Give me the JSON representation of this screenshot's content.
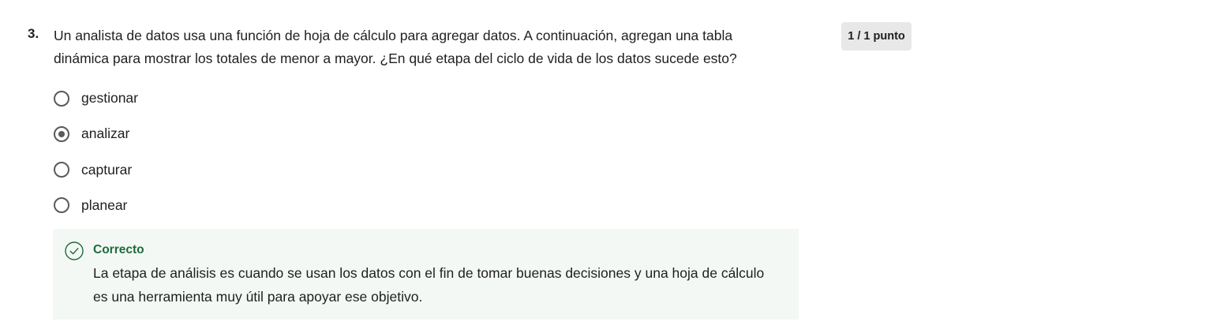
{
  "question": {
    "number": "3.",
    "text": "Un analista de datos usa una función de hoja de cálculo para agregar datos. A continuación, agregan una tabla dinámica para mostrar los totales de menor a mayor. ¿En qué etapa del ciclo de vida de los datos sucede esto?",
    "score": "1 / 1 punto"
  },
  "options": [
    {
      "label": "gestionar",
      "selected": false
    },
    {
      "label": "analizar",
      "selected": true
    },
    {
      "label": "capturar",
      "selected": false
    },
    {
      "label": "planear",
      "selected": false
    }
  ],
  "feedback": {
    "status": "Correcto",
    "icon": "check-circle-icon",
    "text": "La etapa de análisis es cuando se usan los datos con el fin de tomar buenas decisiones y una hoja de cálculo es una herramienta muy útil para apoyar ese objetivo.",
    "accent_color": "#1e6b3b",
    "background_color": "#f3f8f5"
  }
}
